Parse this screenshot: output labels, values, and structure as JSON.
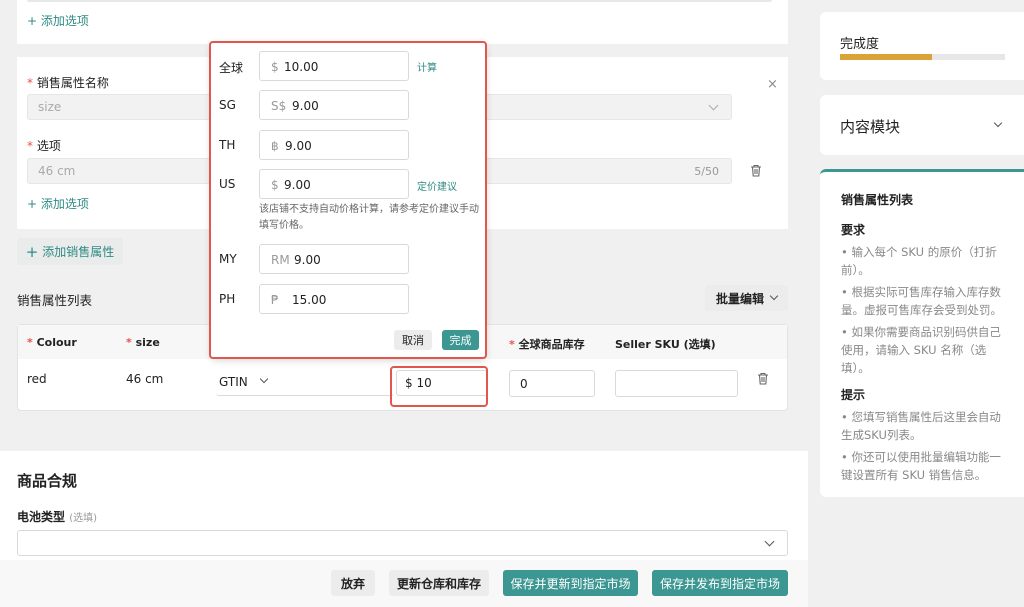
{
  "top": {
    "add_option": "添加选项"
  },
  "attr_block": {
    "name_label": "销售属性名称",
    "name_value": "size",
    "option_label": "选项",
    "option_value": "46 cm",
    "option_count": "5/50",
    "add_option": "添加选项"
  },
  "add_sales_attr": "添加销售属性",
  "sales_list": {
    "title": "销售属性列表",
    "batch_edit": "批量编辑",
    "headers": {
      "colour": "Colour",
      "size": "size",
      "global_stock": "全球商品库存",
      "seller_sku": "Seller SKU (选填)"
    },
    "row": {
      "colour": "red",
      "size": "46 cm",
      "gtin": "GTIN",
      "price": "$ 10",
      "stock": "0"
    }
  },
  "popup": {
    "rows": [
      {
        "label": "全球",
        "currency": "$",
        "value": "10.00",
        "link": "计算"
      },
      {
        "label": "SG",
        "currency": "S$",
        "value": "9.00",
        "link": ""
      },
      {
        "label": "TH",
        "currency": "฿",
        "value": "9.00",
        "link": ""
      },
      {
        "label": "US",
        "currency": "$",
        "value": "9.00",
        "link": "定价建议"
      },
      {
        "label": "MY",
        "currency": "RM",
        "value": "9.00",
        "link": ""
      },
      {
        "label": "PH",
        "currency": "₱",
        "value": "15.00",
        "link": ""
      }
    ],
    "note": "该店铺不支持自动价格计算，请参考定价建议手动填写价格。",
    "cancel": "取消",
    "done": "完成"
  },
  "compliance": {
    "title": "商品合规",
    "battery_label": "电池类型",
    "battery_optional": "(选填)"
  },
  "footer": {
    "discard": "放弃",
    "update_stock": "更新仓库和库存",
    "save_update": "保存并更新到指定市场",
    "save_publish": "保存并发布到指定市场"
  },
  "right": {
    "completion": "完成度",
    "completion_progress": 0.56,
    "content_block": "内容模块",
    "panel_title": "销售属性列表",
    "requirements_title": "要求",
    "requirements": [
      "• 输入每个 SKU 的原价（打折前）。",
      "• 根据实际可售库存输入库存数量。虚报可售库存会受到处罚。",
      "• 如果你需要商品识别码供自己使用，请输入 SKU 名称（选填）。"
    ],
    "tips_title": "提示",
    "tips": [
      "• 您填写销售属性后这里会自动生成SKU列表。",
      "• 你还可以使用批量编辑功能一键设置所有 SKU 销售信息。"
    ]
  },
  "colors": {
    "accent": "#3c9691",
    "highlight": "#e0574f",
    "progress": "#d9a33a"
  }
}
